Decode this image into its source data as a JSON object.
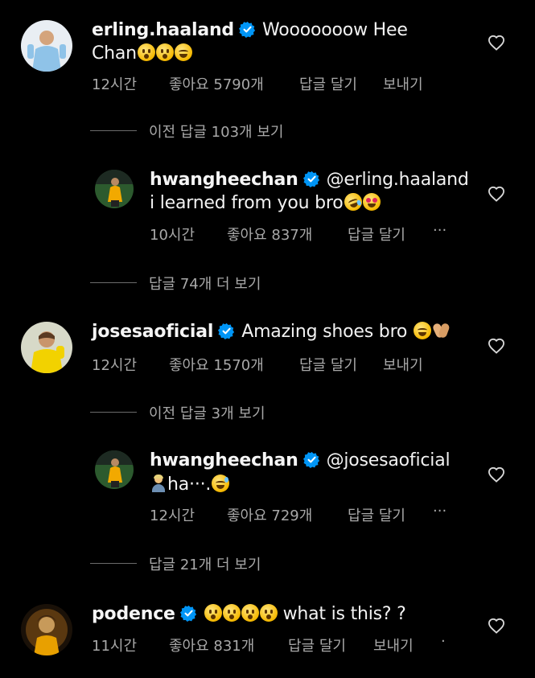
{
  "comments": [
    {
      "username": "erling.haaland",
      "text_line1": "Wooooooow Hee",
      "text_line2": "Chan",
      "time": "12시간",
      "likes": "좋아요 5790개",
      "reply": "답글 달기",
      "send": "보내기"
    },
    {
      "username": "hwangheechan",
      "text_line1": "@erling.haaland",
      "text_line2": "i learned from you bro",
      "time": "10시간",
      "likes": "좋아요 837개",
      "reply": "답글 달기",
      "more": "···"
    },
    {
      "username": "josesaoficial",
      "text_line1": "Amazing shoes bro",
      "time": "12시간",
      "likes": "좋아요 1570개",
      "reply": "답글 달기",
      "send": "보내기"
    },
    {
      "username": "hwangheechan",
      "text_line1": "@josesaoficial",
      "text_line2": "ha···.",
      "time": "12시간",
      "likes": "좋아요 729개",
      "reply": "답글 달기",
      "more": "···"
    },
    {
      "username": "podence",
      "text_line1": "what is this? ?",
      "time": "11시간",
      "likes": "좋아요 831개",
      "reply": "답글 달기",
      "send": "보내기",
      "more": "·"
    }
  ],
  "threads": {
    "prev_replies_1": "이전 답글 103개 보기",
    "more_replies_1": "답글 74개 더 보기",
    "prev_replies_2": "이전 답글 3개 보기",
    "more_replies_2": "답글 21개 더 보기"
  },
  "icons": {
    "verified": "verified-badge-icon",
    "heart": "heart-outline-icon"
  },
  "colors": {
    "background": "#000000",
    "verified_blue": "#0095f6",
    "meta_gray": "#a8a8a8"
  }
}
